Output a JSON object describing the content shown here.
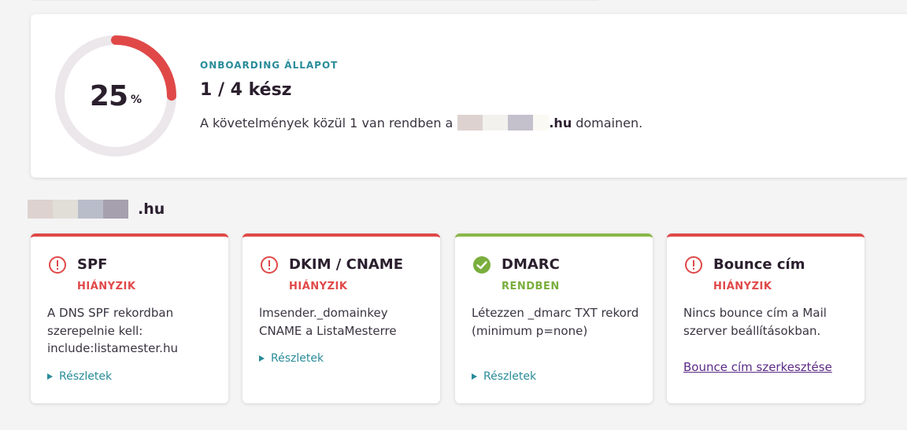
{
  "status": {
    "percent": 25,
    "percent_number": "25",
    "percent_symbol": "%",
    "eyebrow": "ONBOARDING ÁLLAPOT",
    "headline": "1 / 4 kész",
    "desc_prefix": "A követelmények közül 1 van rendben a",
    "desc_domain_suffix": ".hu",
    "desc_suffix": "domainen.",
    "colors": {
      "progress": "#e04848",
      "track": "#ebe7ea"
    }
  },
  "domain": {
    "suffix": ".hu"
  },
  "checks": [
    {
      "title": "SPF",
      "status": "HIÁNYZIK",
      "ok": false,
      "icon": "alert-circle-icon",
      "text": "A DNS SPF rekordban szerepelnie kell: include:listamester.hu",
      "link": "Részletek"
    },
    {
      "title": "DKIM / CNAME",
      "status": "HIÁNYZIK",
      "ok": false,
      "icon": "alert-circle-icon",
      "text": "lmsender._domainkey CNAME a ListaMesterre",
      "link": "Részletek"
    },
    {
      "title": "DMARC",
      "status": "RENDBEN",
      "ok": true,
      "icon": "check-circle-icon",
      "text": "Létezzen _dmarc TXT rekord (minimum p=none)",
      "link": "Részletek"
    },
    {
      "title": "Bounce cím",
      "status": "HIÁNYZIK",
      "ok": false,
      "icon": "alert-circle-icon",
      "text": "Nincs bounce cím a Mail szerver beállításokban.",
      "link": "Bounce cím szerkesztése"
    }
  ]
}
